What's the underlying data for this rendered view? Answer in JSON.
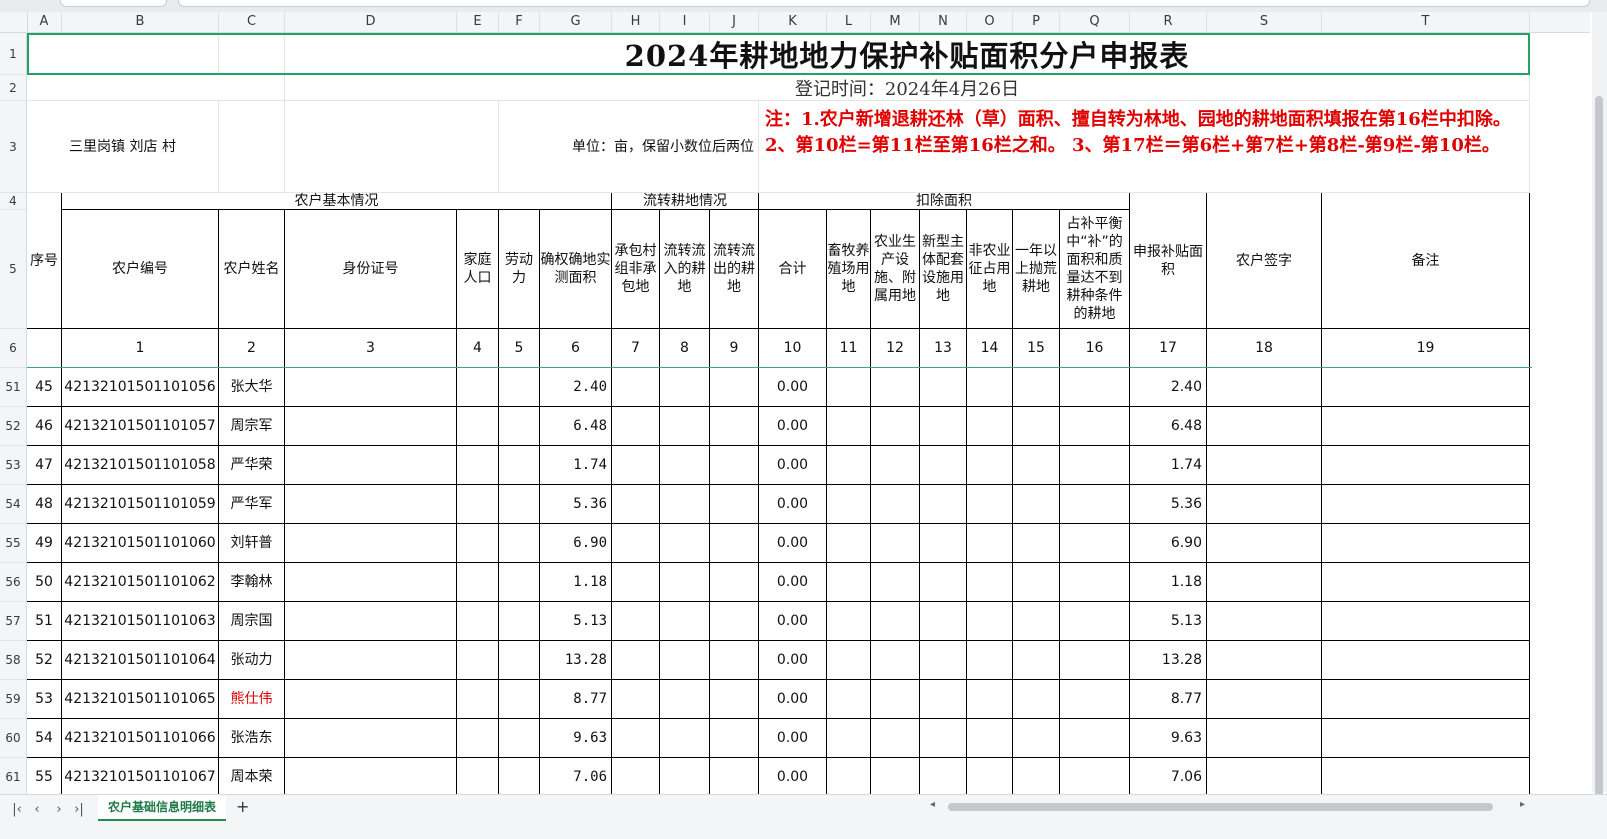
{
  "col_letters": [
    "A",
    "B",
    "C",
    "D",
    "E",
    "F",
    "G",
    "H",
    "I",
    "J",
    "K",
    "L",
    "M",
    "N",
    "O",
    "P",
    "Q",
    "R",
    "S",
    "T"
  ],
  "row_nums": [
    "1",
    "2",
    "3",
    "4",
    "5",
    "6",
    "51",
    "52",
    "53",
    "54",
    "55",
    "56",
    "57",
    "58",
    "59",
    "60",
    "61"
  ],
  "sheet": {
    "title": "2024年耕地地力保护补贴面积分户申报表",
    "reg_time": "登记时间：2024年4月26日",
    "location": "三里岗镇 刘店  村",
    "unit": "单位：亩，保留小数位后两位",
    "note": "注：1.农户新增退耕还林（草）面积、擅自转为林地、园地的耕地面积填报在第16栏中扣除。     2、第10栏=第11栏至第16栏之和。        3、第17栏＝第6栏+第7栏+第8栏-第9栏-第10栏。"
  },
  "headers": {
    "seq": "序号",
    "basic_group": "农户基本情况",
    "transfer_group": "流转耕地情况",
    "deduct_group": "扣除面积",
    "cols": [
      "农户编号",
      "农户姓名",
      "身份证号",
      "家庭人口",
      "劳动力",
      "确权确地实测面积",
      "承包村组非承包地",
      "流转流入的耕地",
      "流转流出的耕地",
      "合计",
      "畜牧养殖场用地",
      "农业生产设施、附属用地",
      "新型主体配套设施用地",
      "非农业征占用地",
      "一年以上抛荒耕地",
      "占补平衡中“补”的面积和质量达不到耕种条件的耕地",
      "申报补贴面积",
      "农户签字",
      "备注"
    ],
    "numbers": [
      "1",
      "2",
      "3",
      "4",
      "5",
      "6",
      "7",
      "8",
      "9",
      "10",
      "11",
      "12",
      "13",
      "14",
      "15",
      "16",
      "17",
      "18",
      "19"
    ]
  },
  "rows": [
    {
      "seq": "45",
      "id": "42132101501101056",
      "name": "张大华",
      "area": "2.40",
      "total": "0.00",
      "declared": "2.40",
      "highlight": false
    },
    {
      "seq": "46",
      "id": "42132101501101057",
      "name": "周宗军",
      "area": "6.48",
      "total": "0.00",
      "declared": "6.48",
      "highlight": false
    },
    {
      "seq": "47",
      "id": "42132101501101058",
      "name": "严华荣",
      "area": "1.74",
      "total": "0.00",
      "declared": "1.74",
      "highlight": false
    },
    {
      "seq": "48",
      "id": "42132101501101059",
      "name": "严华军",
      "area": "5.36",
      "total": "0.00",
      "declared": "5.36",
      "highlight": false
    },
    {
      "seq": "49",
      "id": "42132101501101060",
      "name": "刘轩普",
      "area": "6.90",
      "total": "0.00",
      "declared": "6.90",
      "highlight": false
    },
    {
      "seq": "50",
      "id": "42132101501101062",
      "name": "李翰林",
      "area": "1.18",
      "total": "0.00",
      "declared": "1.18",
      "highlight": false
    },
    {
      "seq": "51",
      "id": "42132101501101063",
      "name": "周宗国",
      "area": "5.13",
      "total": "0.00",
      "declared": "5.13",
      "highlight": false
    },
    {
      "seq": "52",
      "id": "42132101501101064",
      "name": "张动力",
      "area": "13.28",
      "total": "0.00",
      "declared": "13.28",
      "highlight": false
    },
    {
      "seq": "53",
      "id": "42132101501101065",
      "name": "熊仕伟",
      "area": "8.77",
      "total": "0.00",
      "declared": "8.77",
      "highlight": true
    },
    {
      "seq": "54",
      "id": "42132101501101066",
      "name": "张浩东",
      "area": "9.63",
      "total": "0.00",
      "declared": "9.63",
      "highlight": false
    },
    {
      "seq": "55",
      "id": "42132101501101067",
      "name": "周本荣",
      "area": "7.06",
      "total": "0.00",
      "declared": "7.06",
      "highlight": false
    }
  ],
  "tabs": {
    "active": "农户基础信息明细表",
    "add": "+"
  },
  "nav": {
    "first": "|‹",
    "prev": "‹",
    "next": "›",
    "last": "›|"
  },
  "colors": {
    "accent": "#21a366",
    "red": "#e00000",
    "tab_text": "#1e7a46"
  }
}
